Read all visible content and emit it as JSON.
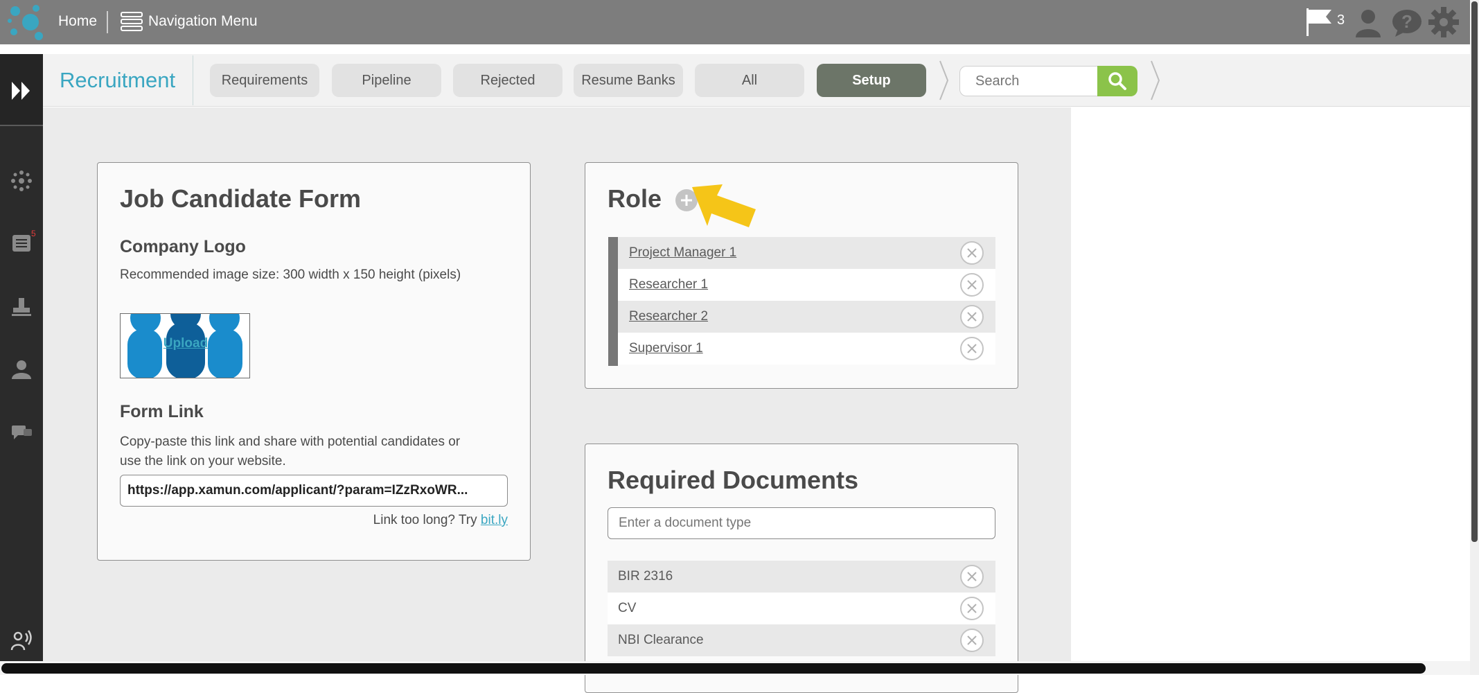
{
  "topbar": {
    "home_label": "Home",
    "nav_menu_label": "Navigation Menu",
    "flag_count": "3"
  },
  "sidebar": {
    "notification_badge": "5"
  },
  "module": {
    "title": "Recruitment",
    "tabs": [
      {
        "label": "Requirements",
        "active": false
      },
      {
        "label": "Pipeline",
        "active": false
      },
      {
        "label": "Rejected",
        "active": false
      },
      {
        "label": "Resume Banks",
        "active": false
      },
      {
        "label": "All",
        "active": false
      },
      {
        "label": "Setup",
        "active": true
      }
    ],
    "search_placeholder": "Search"
  },
  "candidate_form": {
    "title": "Job Candidate Form",
    "logo_heading": "Company Logo",
    "logo_hint": "Recommended image size: 300 width x 150 height (pixels)",
    "upload_label": "Upload",
    "link_heading": "Form Link",
    "link_desc_line1": "Copy-paste this link and share with potential candidates or",
    "link_desc_line2": "use the link on your website.",
    "link_value": "https://app.xamun.com/applicant/?param=IZzRxoWR...",
    "bitly_prefix": "Link too long? Try ",
    "bitly_link": "bit.ly"
  },
  "roles": {
    "title": "Role",
    "items": [
      "Project Manager 1",
      "Researcher 1",
      "Researcher 2",
      "Supervisor 1"
    ]
  },
  "documents": {
    "title": "Required Documents",
    "input_placeholder": "Enter a document type",
    "items": [
      "BIR 2316",
      "CV",
      "NBI Clearance"
    ]
  },
  "colors": {
    "accent": "#3aa6c1",
    "search_button": "#8bc34a",
    "active_tab": "#6c7568",
    "topbar": "#7d7d7d",
    "arrow": "#f5c518"
  }
}
